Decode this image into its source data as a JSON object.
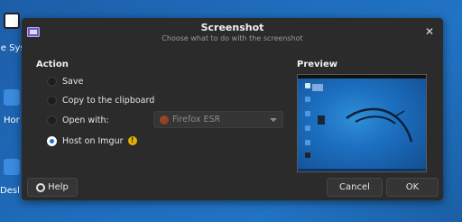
{
  "desktop": {
    "items": [
      {
        "label": "le Sys"
      },
      {
        "label": "Hor"
      },
      {
        "label": "Desl"
      }
    ]
  },
  "dialog": {
    "title": "Screenshot",
    "subtitle": "Choose what to do with the screenshot",
    "action": {
      "heading": "Action",
      "options": [
        {
          "label": "Save",
          "checked": false
        },
        {
          "label": "Copy to the clipboard",
          "checked": false
        },
        {
          "label": "Open with:",
          "checked": false
        },
        {
          "label": "Host on Imgur",
          "checked": true
        }
      ],
      "open_with_app": "Firefox ESR"
    },
    "preview": {
      "heading": "Preview"
    },
    "buttons": {
      "help": "Help",
      "cancel": "Cancel",
      "ok": "OK"
    }
  },
  "icons": {
    "app": "screenshot-app-icon",
    "close": "close-icon",
    "warning": "warning-icon",
    "help": "help-icon",
    "dropdown": "chevron-down-icon",
    "browser": "firefox-icon"
  },
  "colors": {
    "dialog_bg": "#2b2b2b",
    "accent": "#1f6fd1",
    "warning": "#e5b100"
  }
}
